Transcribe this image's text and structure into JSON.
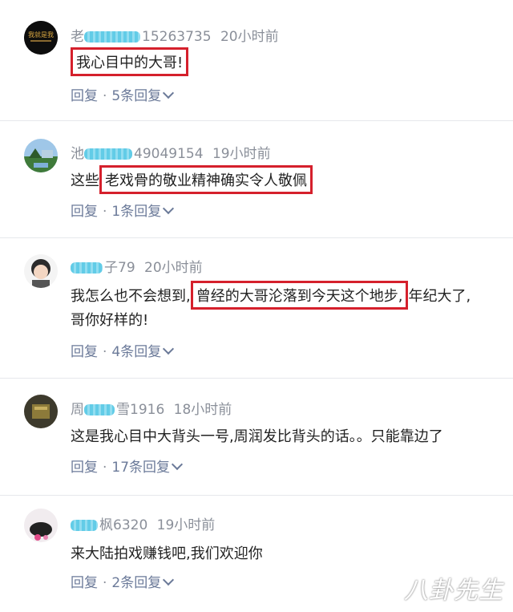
{
  "comments": [
    {
      "username": "老",
      "username_suffix": "15263735",
      "time": "20小时前",
      "text_before": "",
      "text_highlight": "我心目中的大哥!",
      "text_after": "",
      "text_line2": "",
      "reply_label": "回复",
      "replies": "5条回复",
      "avatar_text": "我就是我"
    },
    {
      "username": "池",
      "username_suffix": "49049154",
      "time": "19小时前",
      "text_before": "这些",
      "text_highlight": "老戏骨的敬业精神确实令人敬佩",
      "text_after": "",
      "text_line2": "",
      "reply_label": "回复",
      "replies": "1条回复"
    },
    {
      "username": "",
      "username_suffix": "子79",
      "time": "20小时前",
      "text_before": "我怎么也不会想到,",
      "text_highlight": "曾经的大哥沦落到今天这个地步,",
      "text_after": "年纪大了,",
      "text_line2": "哥你好样的!",
      "reply_label": "回复",
      "replies": "4条回复"
    },
    {
      "username": "周",
      "username_suffix": "雪1916",
      "time": "18小时前",
      "text_before": "这是我心目中大背头一号,周润发比背头的话。。只能靠边了",
      "text_highlight": "",
      "text_after": "",
      "text_line2": "",
      "reply_label": "回复",
      "replies": "17条回复"
    },
    {
      "username": "",
      "username_suffix": "枫6320",
      "time": "19小时前",
      "text_before": "来大陆拍戏赚钱吧,我们欢迎你",
      "text_highlight": "",
      "text_after": "",
      "text_line2": "",
      "reply_label": "回复",
      "replies": "2条回复"
    }
  ],
  "watermark": "八卦先生",
  "colors": {
    "highlight": "#d5202c",
    "meta": "#8a8f99",
    "action": "#6b7a99"
  }
}
